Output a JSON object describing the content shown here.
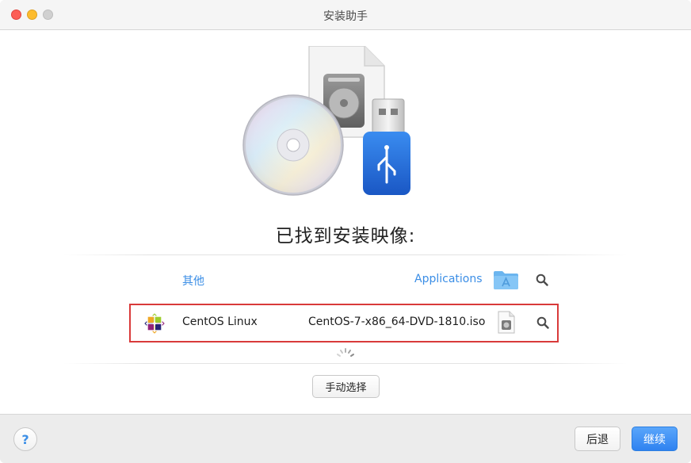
{
  "window": {
    "title": "安装助手"
  },
  "main": {
    "heading": "已找到安装映像:",
    "header_row": {
      "left_label": "其他",
      "right_label": "Applications"
    },
    "found_image": {
      "os_name": "CentOS Linux",
      "file_name": "CentOS-7-x86_64-DVD-1810.iso"
    },
    "manual_button": "手动选择"
  },
  "footer": {
    "help_label": "?",
    "back_label": "后退",
    "continue_label": "继续"
  },
  "icons": {
    "hero": "install-media-icon",
    "folder": "applications-folder-icon",
    "search": "search-icon",
    "disk_image": "disk-image-file-icon",
    "centos": "centos-logo-icon",
    "spinner": "loading-spinner-icon"
  },
  "colors": {
    "accent": "#3b8ee6",
    "highlight_border": "#d93a3a",
    "primary_button": "#2f82f0"
  }
}
